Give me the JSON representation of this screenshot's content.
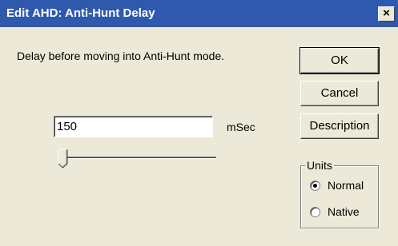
{
  "window": {
    "title": "Edit AHD: Anti-Hunt Delay",
    "close_glyph": "×"
  },
  "description": "Delay before moving into Anti-Hunt mode.",
  "input": {
    "value": "150",
    "unit": "mSec"
  },
  "slider": {
    "position": 0
  },
  "buttons": {
    "ok": "OK",
    "cancel": "Cancel",
    "description": "Description"
  },
  "units": {
    "legend": "Units",
    "options": [
      {
        "label": "Normal",
        "selected": true
      },
      {
        "label": "Native",
        "selected": false
      }
    ]
  }
}
